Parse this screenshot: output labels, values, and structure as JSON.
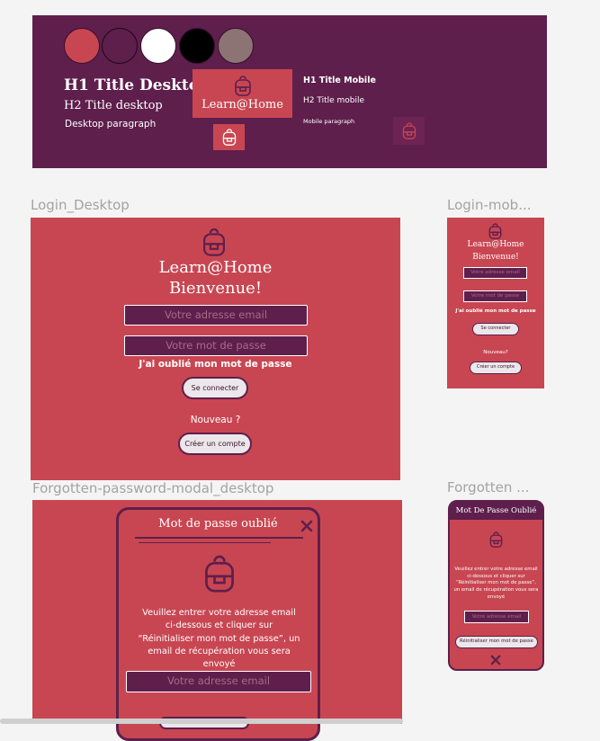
{
  "style_guide": {
    "colors": [
      "#c84652",
      "#5e1f4c",
      "#ffffff",
      "#000000",
      "#8d7474"
    ],
    "h1_desktop": "H1 Title Desktop",
    "h2_desktop": "H2 Title desktop",
    "p_desktop": "Desktop paragraph",
    "logo_label": "Learn@Home",
    "h1_mobile": "H1 Title Mobile",
    "h2_mobile": "H2 Title mobile",
    "p_mobile": "Mobile paragraph"
  },
  "frames": {
    "login_desktop": "Login_Desktop",
    "login_mobile": "Login-mob...",
    "modal_desktop": "Forgotten-password-modal_desktop",
    "modal_mobile": "Forgotten ..."
  },
  "login_desktop": {
    "brand": "Learn@Home",
    "welcome": "Bienvenue!",
    "email_placeholder": "Votre adresse email",
    "password_placeholder": "Votre mot de passe",
    "forgot": "J'ai oublié mon mot de passe",
    "login_button": "Se connecter",
    "new_text": "Nouveau ?",
    "create_button": "Créer un compte"
  },
  "login_mobile": {
    "brand": "Learn@Home",
    "welcome": "Bienvenue!",
    "email_placeholder": "Votre adresse email",
    "password_placeholder": "Votre mot de passe",
    "forgot": "J'ai oublié mon mot de passe",
    "login_button": "Se connecter",
    "new_text": "Nouveau?",
    "create_button": "Créer un compte"
  },
  "modal_desktop": {
    "title": "Mot de passe oublié",
    "instructions": "Veuillez entrer votre adresse email ci-dessous et cliquer sur “Réinitialiser mon mot de passe”, un email de récupération vous sera envoyé",
    "email_placeholder": "Votre adresse email"
  },
  "modal_mobile": {
    "title": "Mot De Passe Oublié",
    "instructions": "Veuillez entrer votre adresse email ci-dessous et cliquer sur “Réinitialiser mon mot de passe”, un email de récupération vous sera envoyé",
    "email_placeholder": "Votre adresse email",
    "reset_button": "Réinitialiser mon mot de passe"
  },
  "icons": {
    "logo": "backpack-icon",
    "close": "close-icon"
  }
}
